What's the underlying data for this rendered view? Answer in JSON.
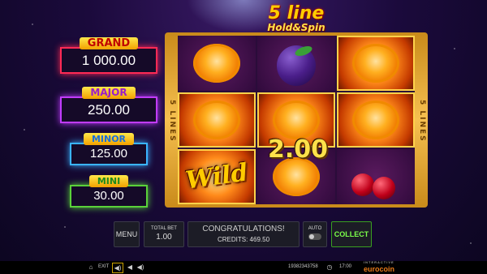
{
  "logo": {
    "line1": "5 line",
    "line2": "Hold&Spin"
  },
  "jackpots": [
    {
      "label": "GRAND",
      "value": "1 000.00"
    },
    {
      "label": "MAJOR",
      "value": "250.00"
    },
    {
      "label": "MINOR",
      "value": "125.00"
    },
    {
      "label": "MINI",
      "value": "30.00"
    }
  ],
  "reels": {
    "side_text": "5 LINES",
    "symbols": [
      "orange",
      "plum",
      "orange",
      "orange",
      "orange",
      "orange",
      "wild",
      "orange",
      "cherry"
    ],
    "wild_text": "Wild",
    "win_amount": "2.00"
  },
  "controls": {
    "menu_label": "MENU",
    "total_bet_label": "TOTAL BET",
    "total_bet_value": "1.00",
    "message": "CONGRATULATIONS!",
    "credits": "CREDITS: 469.50",
    "auto_label": "AUTO",
    "collect_label": "COLLECT"
  },
  "status_bar": {
    "exit_label": "EXIT",
    "game_id": "19382343758",
    "time": "17:00",
    "brand": "eurocoin",
    "brand_sub": "INTERACTIVE"
  }
}
